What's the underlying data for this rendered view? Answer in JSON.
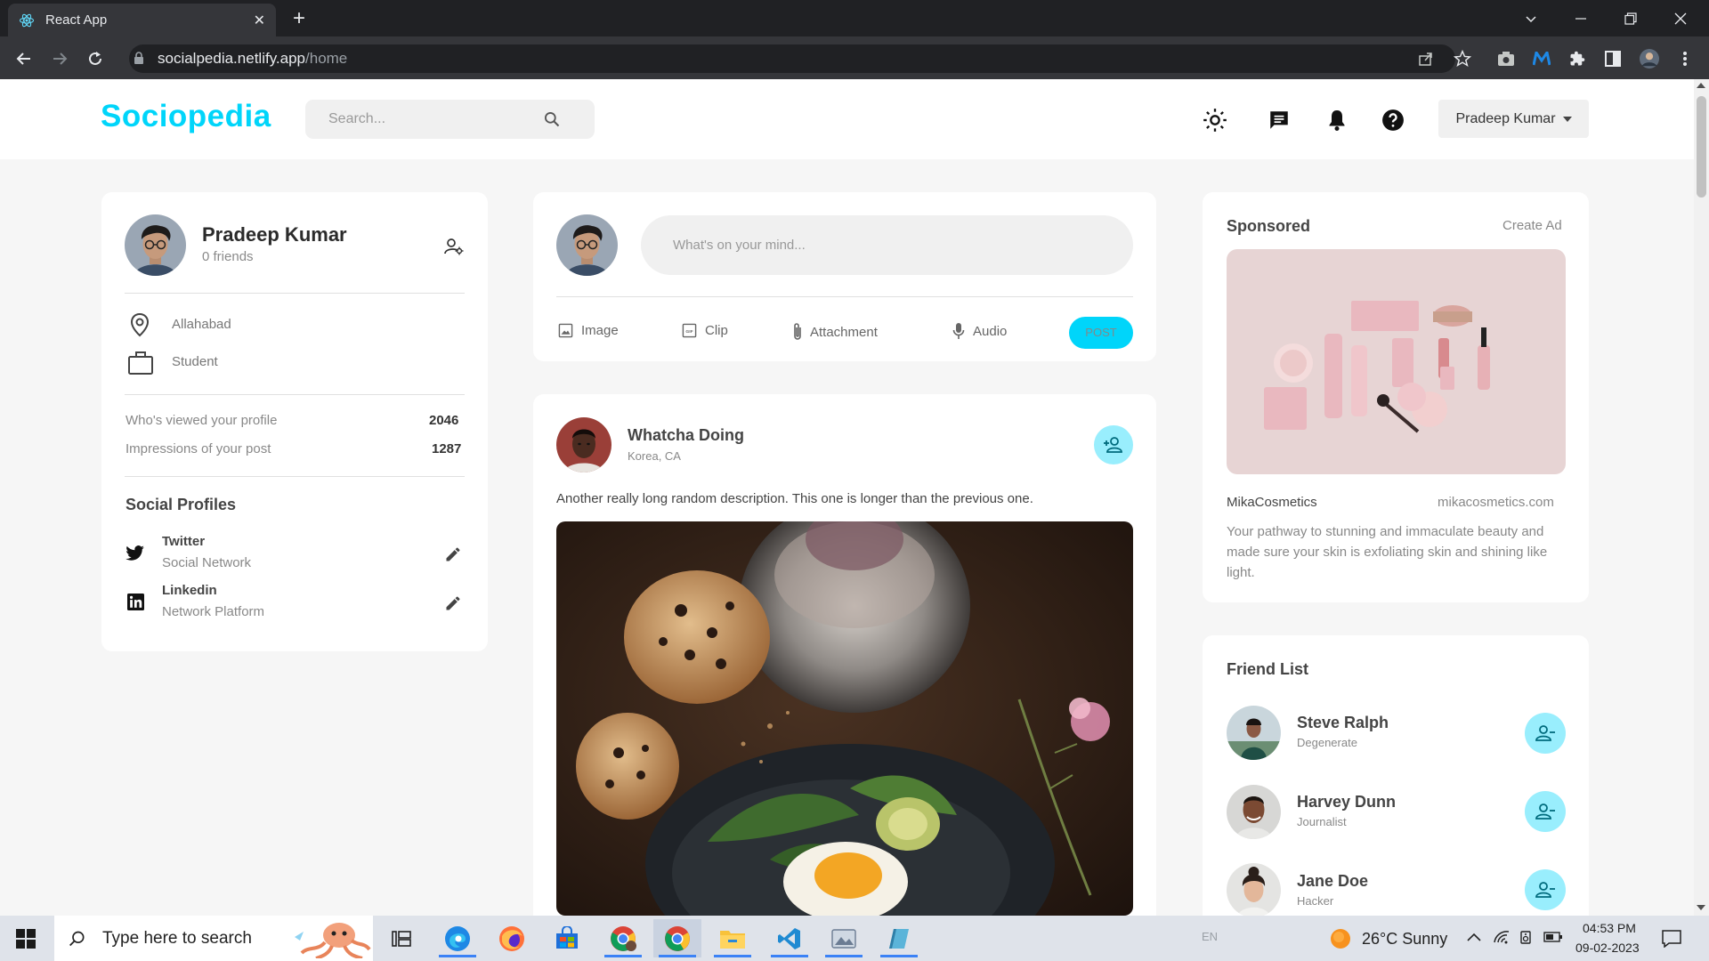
{
  "browser": {
    "tab_title": "React App",
    "tab_close": "✕",
    "new_tab": "+",
    "url_host": "socialpedia.netlify.app",
    "url_path": "/home"
  },
  "header": {
    "logo": "Sociopedia",
    "search_placeholder": "Search...",
    "user_menu": "Pradeep Kumar",
    "brand_color": "#00d5fa"
  },
  "profile": {
    "name": "Pradeep Kumar",
    "friends": "0 friends",
    "location": "Allahabad",
    "occupation": "Student",
    "stats": [
      {
        "label": "Who's viewed your profile",
        "value": "2046"
      },
      {
        "label": "Impressions of your post",
        "value": "1287"
      }
    ],
    "social_title": "Social Profiles",
    "socials": [
      {
        "name": "Twitter",
        "subtitle": "Social Network"
      },
      {
        "name": "Linkedin",
        "subtitle": "Network Platform"
      }
    ]
  },
  "composer": {
    "placeholder": "What's on your mind...",
    "actions": [
      "Image",
      "Clip",
      "Attachment",
      "Audio"
    ],
    "post_label": "POST"
  },
  "post": {
    "author": "Whatcha Doing",
    "location": "Korea, CA",
    "description": "Another really long random description. This one is longer than the previous one."
  },
  "sponsored": {
    "title": "Sponsored",
    "create_ad": "Create Ad",
    "brand": "MikaCosmetics",
    "site": "mikacosmetics.com",
    "text": "Your pathway to stunning and immaculate beauty and made sure your skin is exfoliating skin and shining like light."
  },
  "friends": {
    "title": "Friend List",
    "items": [
      {
        "name": "Steve Ralph",
        "role": "Degenerate"
      },
      {
        "name": "Harvey Dunn",
        "role": "Journalist"
      },
      {
        "name": "Jane Doe",
        "role": "Hacker"
      }
    ]
  },
  "taskbar": {
    "search_placeholder": "Type here to search",
    "language": "EN",
    "weather": "26°C  Sunny",
    "time": "04:53 PM",
    "date": "09-02-2023"
  }
}
